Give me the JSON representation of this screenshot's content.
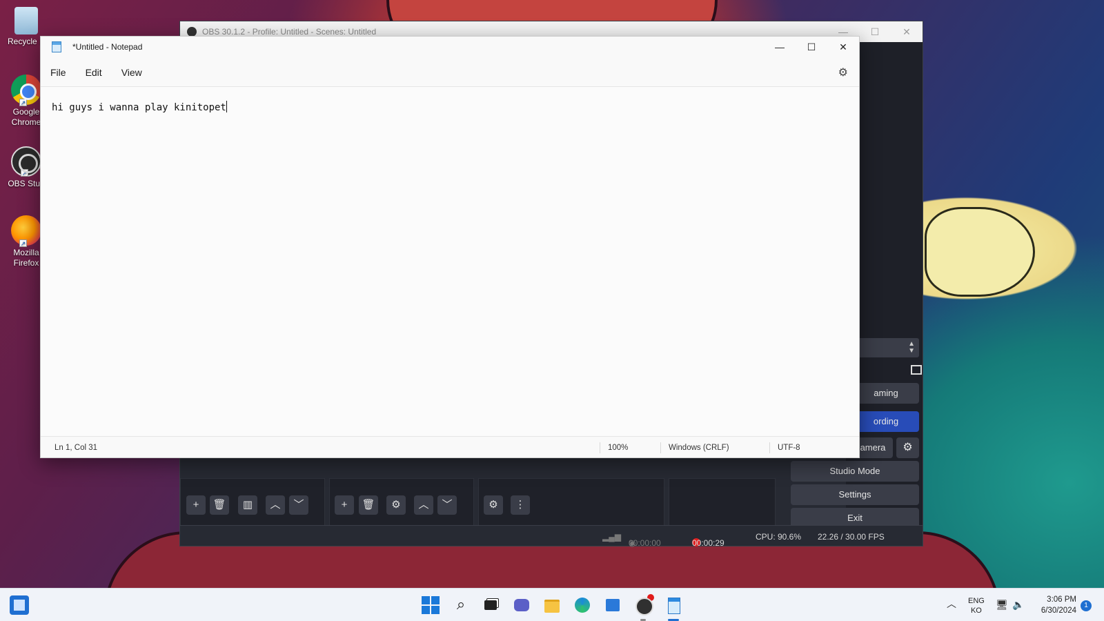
{
  "desktop": {
    "icons": [
      {
        "label": "Recycle B",
        "icon": "recycle-bin-icon"
      },
      {
        "label": "Google Chrome",
        "icon": "chrome-icon"
      },
      {
        "label": "OBS Stud",
        "icon": "obs-icon"
      },
      {
        "label": "Mozilla Firefox",
        "icon": "firefox-icon"
      }
    ]
  },
  "obs": {
    "title": "OBS 30.1.2 - Profile: Untitled - Scenes: Untitled",
    "controls": {
      "streaming": "aming",
      "recording": "ording",
      "camera": "amera",
      "studio_mode": "Studio Mode",
      "settings": "Settings",
      "exit": "Exit"
    },
    "status": {
      "stream_time": "00:00:00",
      "rec_time": "00:00:29",
      "cpu": "CPU: 90.6%",
      "fps": "22.26 / 30.00 FPS"
    },
    "colors": {
      "accent": "#284cb8",
      "recording": "#e02020"
    }
  },
  "notepad": {
    "title": "*Untitled - Notepad",
    "menu": {
      "file": "File",
      "edit": "Edit",
      "view": "View"
    },
    "content": "hi guys i wanna play kinitopet",
    "status": {
      "position": "Ln 1, Col 31",
      "zoom": "100%",
      "line_ending": "Windows (CRLF)",
      "encoding": "UTF-8"
    }
  },
  "taskbar": {
    "language": {
      "line1": "ENG",
      "line2": "KO"
    },
    "time": "3:06 PM",
    "date": "6/30/2024",
    "notification_count": "1",
    "accent": "#1f6fd1"
  }
}
